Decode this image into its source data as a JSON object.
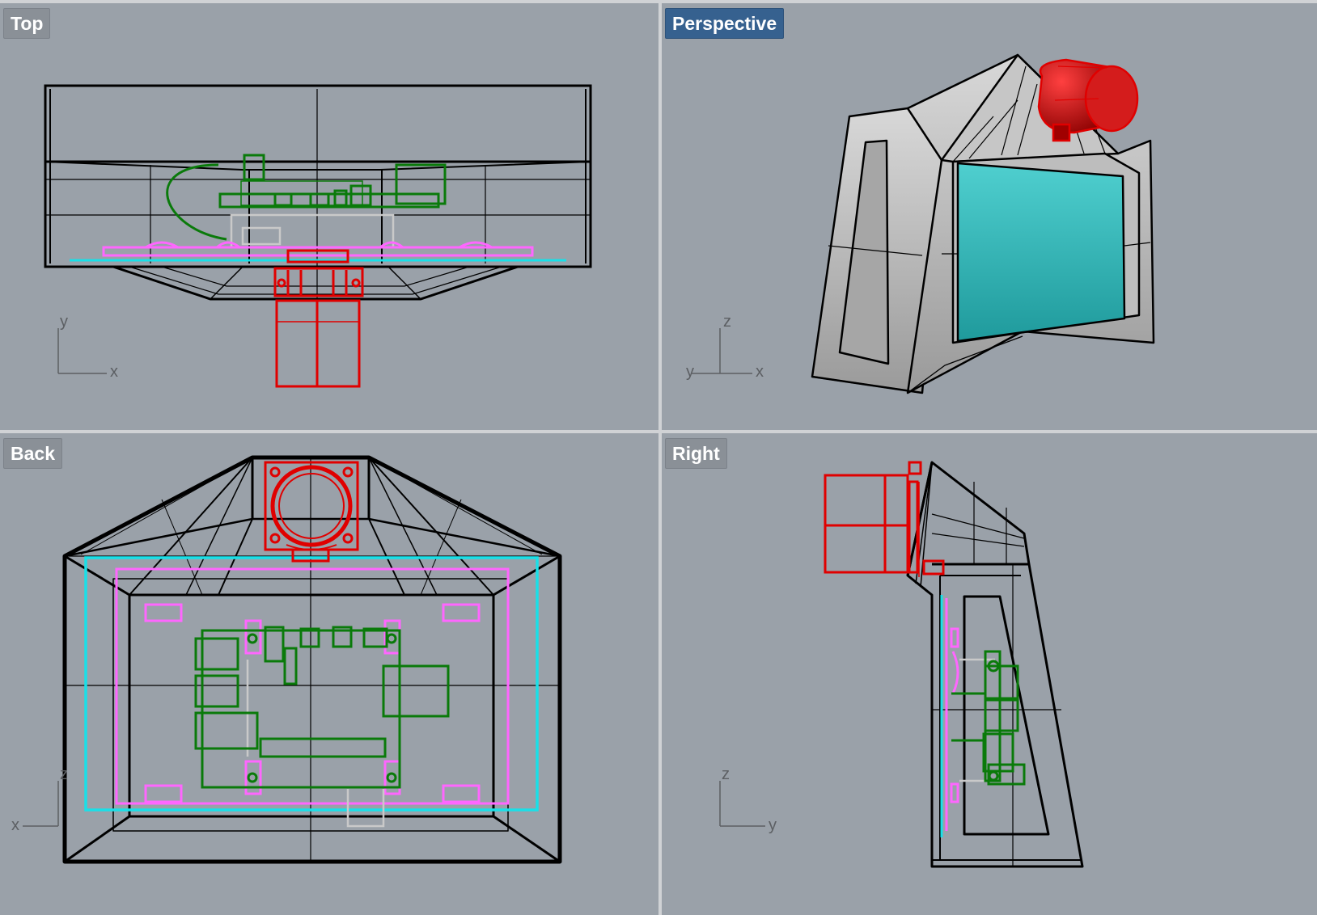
{
  "viewports": {
    "top": {
      "label": "Top",
      "axes": {
        "h": "x",
        "v": "y"
      }
    },
    "perspective": {
      "label": "Perspective",
      "active": true,
      "axes": {
        "h": "x",
        "v": "z",
        "depth": "y"
      }
    },
    "back": {
      "label": "Back",
      "axes": {
        "h": "x",
        "v": "z"
      }
    },
    "right": {
      "label": "Right",
      "axes": {
        "h": "y",
        "v": "z"
      }
    }
  },
  "colors": {
    "viewport_bg": "#9aa1a9",
    "active_label": "#36618f",
    "wire": "#000000",
    "camera": "#e00000",
    "board": "#0a7a0a",
    "screen": "#19e0e8",
    "mounts": "#ff66ff",
    "gray_parts": "#c9c9c9"
  }
}
